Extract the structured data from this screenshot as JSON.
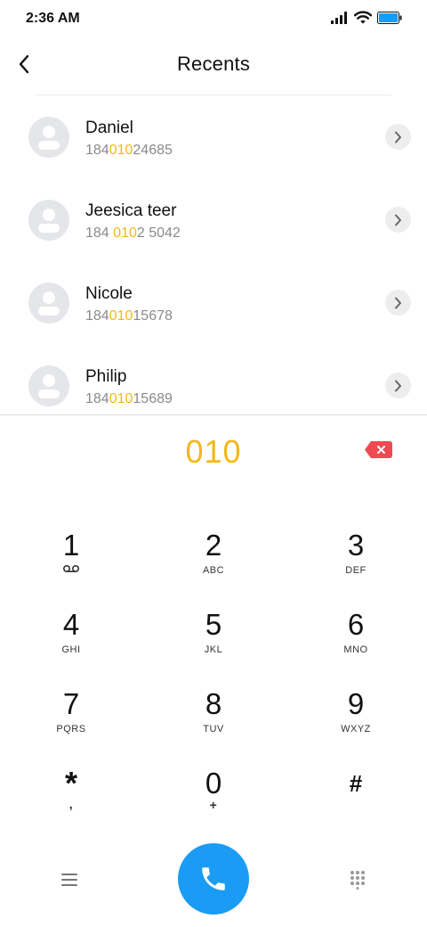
{
  "status_bar": {
    "time": "2:36 AM"
  },
  "header": {
    "title": "Recents"
  },
  "contacts": [
    {
      "name": "Daniel",
      "number_parts": [
        "184",
        "010",
        "24685"
      ]
    },
    {
      "name": "Jeesica teer",
      "number_parts": [
        "184 ",
        "010",
        "2 5042"
      ]
    },
    {
      "name": "Nicole",
      "number_parts": [
        "184",
        "010",
        "15678"
      ]
    },
    {
      "name": "Philip",
      "number_parts": [
        "184",
        "010",
        "15689"
      ]
    }
  ],
  "dialer": {
    "input": "010"
  },
  "keypad": {
    "keys": [
      {
        "digit": "1",
        "letters": ""
      },
      {
        "digit": "2",
        "letters": "ABC"
      },
      {
        "digit": "3",
        "letters": "DEF"
      },
      {
        "digit": "4",
        "letters": "GHI"
      },
      {
        "digit": "5",
        "letters": "JKL"
      },
      {
        "digit": "6",
        "letters": "MNO"
      },
      {
        "digit": "7",
        "letters": "PQRS"
      },
      {
        "digit": "8",
        "letters": "TUV"
      },
      {
        "digit": "9",
        "letters": "WXYZ"
      },
      {
        "digit": "*",
        "letters": ","
      },
      {
        "digit": "0",
        "letters": "+"
      },
      {
        "digit": "#",
        "letters": ""
      }
    ]
  },
  "colors": {
    "accent_highlight": "#f2b81a",
    "call_button": "#1a9cf4",
    "backspace": "#ee4a52",
    "battery": "#1a9cf4"
  },
  "icons": {
    "back": "chevron-left-icon",
    "detail": "chevron-right-icon",
    "backspace": "backspace-icon",
    "voicemail": "voicemail-icon",
    "menu": "menu-icon",
    "call": "phone-icon",
    "keypad_toggle": "dialpad-icon"
  }
}
